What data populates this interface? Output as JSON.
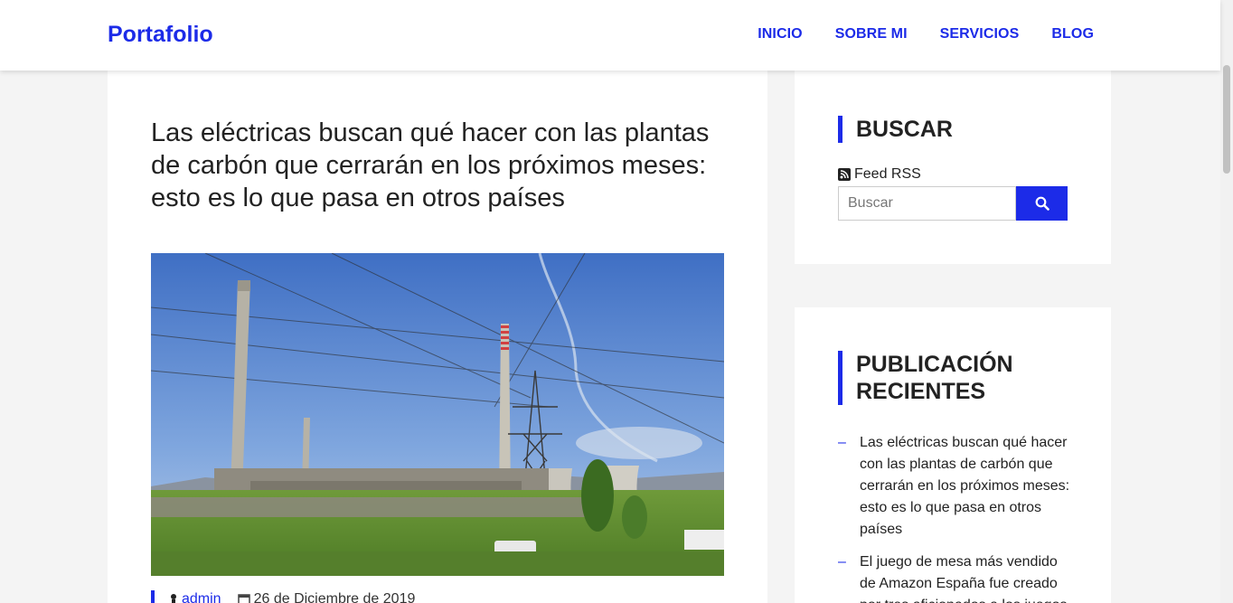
{
  "header": {
    "brand": "Portafolio",
    "nav": [
      "INICIO",
      "SOBRE MI",
      "SERVICIOS",
      "BLOG"
    ]
  },
  "post": {
    "title": "Las eléctricas buscan qué hacer con las plantas de carbón que cerrarán en los próximos meses: esto es lo que pasa en otros países",
    "author": "admin",
    "date": "26 de Diciembre de 2019"
  },
  "sidebar": {
    "search": {
      "title": "BUSCAR",
      "rss_label": "Feed RSS",
      "placeholder": "Buscar"
    },
    "recent": {
      "title": "PUBLICACIÓN RECIENTES",
      "items": [
        "Las eléctricas buscan qué hacer con las plantas de carbón que cerrarán en los próximos meses: esto es lo que pasa en otros países",
        "El juego de mesa más vendido de Amazon España fue creado por tres aficionados a los juegos"
      ]
    }
  },
  "colors": {
    "accent": "#1c2be8",
    "background": "#f4f4f4"
  },
  "icons": {
    "rss": "rss-icon",
    "search": "search-icon",
    "author": "user-icon",
    "date": "calendar-icon"
  }
}
